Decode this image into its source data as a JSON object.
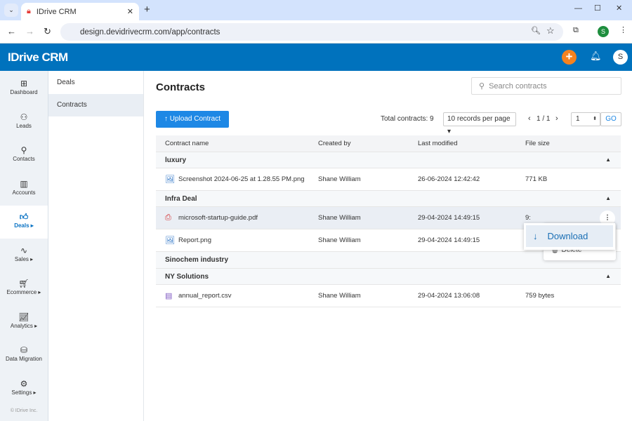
{
  "browser": {
    "tab_title": "IDrive CRM",
    "url": "design.devidrivecrm.com/app/contracts",
    "profile": "S"
  },
  "app": {
    "logo": "IDrive CRM",
    "user_initial": "S"
  },
  "leftnav": [
    {
      "label": "Dashboard",
      "icon": "dashboard-icon"
    },
    {
      "label": "Leads",
      "icon": "leads-icon"
    },
    {
      "label": "Contacts",
      "icon": "contacts-icon"
    },
    {
      "label": "Accounts",
      "icon": "accounts-icon"
    },
    {
      "label": "Deals ▸",
      "icon": "thumbs-up-icon",
      "active": true
    },
    {
      "label": "Sales ▸",
      "icon": "sales-icon"
    },
    {
      "label": "Ecommerce ▸",
      "icon": "ecommerce-icon"
    },
    {
      "label": "Analytics ▸",
      "icon": "analytics-icon"
    },
    {
      "label": "Data Migration",
      "icon": "data-migration-icon"
    },
    {
      "label": "Settings ▸",
      "icon": "gear-icon"
    }
  ],
  "copyright": "© IDrive Inc.",
  "subnav": [
    {
      "label": "Deals"
    },
    {
      "label": "Contracts",
      "active": true
    }
  ],
  "main": {
    "title": "Contracts",
    "search_placeholder": "Search contracts",
    "upload_label": "Upload Contract",
    "total": "Total contracts: 9",
    "per_page": "10 records per page",
    "page": "1 / 1",
    "page_input": "1",
    "go": "GO"
  },
  "table": {
    "headers": [
      "Contract name",
      "Created by",
      "Last modified",
      "File size"
    ],
    "groups": [
      {
        "name": "luxury",
        "rows": [
          {
            "name": "Screenshot 2024-06-25 at 1.28.55 PM.png",
            "type": "image",
            "by": "Shane William",
            "modified": "26-06-2024 12:42:42",
            "size": "771 KB"
          }
        ]
      },
      {
        "name": "Infra Deal",
        "rows": [
          {
            "name": "microsoft-startup-guide.pdf",
            "type": "pdf",
            "by": "Shane William",
            "modified": "29-04-2024 14:49:15",
            "size": "9:"
          },
          {
            "name": "Report.png",
            "type": "image",
            "by": "Shane William",
            "modified": "29-04-2024 14:49:15",
            "size": ""
          }
        ]
      },
      {
        "name": "Sinochem industry",
        "rows": []
      },
      {
        "name": "NY Solutions",
        "rows": [
          {
            "name": "annual_report.csv",
            "type": "csv",
            "by": "Shane William",
            "modified": "29-04-2024 13:06:08",
            "size": "759 bytes"
          }
        ]
      }
    ]
  },
  "menu": {
    "download": "Download",
    "delete": "Delete"
  },
  "colors": {
    "brand": "#0072bd",
    "accent": "#1e88e5",
    "orange": "#f5821f"
  }
}
